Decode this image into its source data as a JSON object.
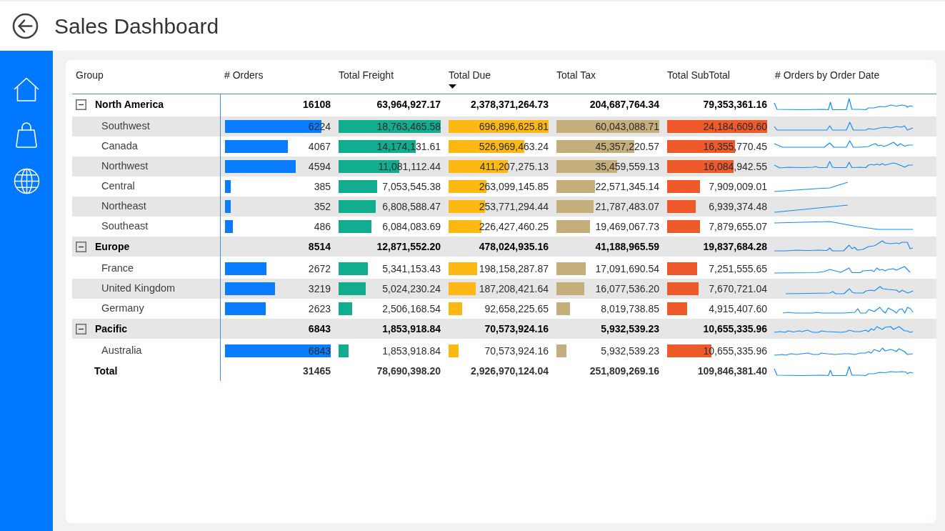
{
  "header": {
    "title": "Sales Dashboard"
  },
  "table": {
    "columns": [
      {
        "label": "Group",
        "kind": "label",
        "sorted": false
      },
      {
        "label": "# Orders",
        "kind": "measure",
        "sorted": false,
        "color": "#0a7cff"
      },
      {
        "label": "Total Freight",
        "kind": "measure",
        "sorted": false,
        "color": "#12ac8e"
      },
      {
        "label": "Total Due",
        "kind": "measure",
        "sorted": true,
        "color": "#fdb813"
      },
      {
        "label": "Total Tax",
        "kind": "measure",
        "sorted": false,
        "color": "#c4ae7b"
      },
      {
        "label": "Total SubTotal",
        "kind": "measure",
        "sorted": false,
        "color": "#ef5a2a"
      },
      {
        "label": "# Orders by Order Date",
        "kind": "sparkline",
        "sorted": false
      }
    ],
    "rows": [
      {
        "label": "North America",
        "expanded": true,
        "cells": [
          "16108",
          "63,964,927.17",
          "2,378,371,264.73",
          "204,687,764.34",
          "79,353,361.16"
        ],
        "children": [
          {
            "label": "Southwest",
            "cells": [
              {
                "value": "6224",
                "level": 0.91
              },
              {
                "value": "18,763,465.58",
                "level": 1
              },
              {
                "value": "696,896,625.81",
                "level": 1
              },
              {
                "value": "60,043,088.71",
                "level": 1
              },
              {
                "value": "24,184,609.60",
                "level": 1
              }
            ]
          },
          {
            "label": "Canada",
            "cells": [
              {
                "value": "4067",
                "level": 0.594
              },
              {
                "value": "14,174,131.61",
                "level": 0.755
              },
              {
                "value": "526,969,463.24",
                "level": 0.756
              },
              {
                "value": "45,357,220.57",
                "level": 0.755
              },
              {
                "value": "16,355,770.45",
                "level": 0.676
              }
            ]
          },
          {
            "label": "Northwest",
            "cells": [
              {
                "value": "4594",
                "level": 0.671
              },
              {
                "value": "11,081,112.44",
                "level": 0.591
              },
              {
                "value": "411,207,275.13",
                "level": 0.59
              },
              {
                "value": "35,459,559.13",
                "level": 0.591
              },
              {
                "value": "16,084,942.55",
                "level": 0.665
              }
            ]
          },
          {
            "label": "Central",
            "cells": [
              {
                "value": "385",
                "level": 0.056
              },
              {
                "value": "7,053,545.38",
                "level": 0.376
              },
              {
                "value": "263,099,145.85",
                "level": 0.378
              },
              {
                "value": "22,571,345.14",
                "level": 0.376
              },
              {
                "value": "7,909,009.01",
                "level": 0.327
              }
            ]
          },
          {
            "label": "Northeast",
            "cells": [
              {
                "value": "352",
                "level": 0.051
              },
              {
                "value": "6,808,588.47",
                "level": 0.363
              },
              {
                "value": "253,771,294.44",
                "level": 0.364
              },
              {
                "value": "21,787,483.07",
                "level": 0.363
              },
              {
                "value": "6,939,374.48",
                "level": 0.287
              }
            ]
          },
          {
            "label": "Southeast",
            "cells": [
              {
                "value": "486",
                "level": 0.071
              },
              {
                "value": "6,084,083.69",
                "level": 0.324
              },
              {
                "value": "226,427,460.25",
                "level": 0.325
              },
              {
                "value": "19,469,067.73",
                "level": 0.324
              },
              {
                "value": "7,879,655.07",
                "level": 0.326
              }
            ]
          }
        ]
      },
      {
        "label": "Europe",
        "expanded": true,
        "cells": [
          "8514",
          "12,871,552.20",
          "478,024,935.16",
          "41,188,965.59",
          "19,837,684.28"
        ],
        "children": [
          {
            "label": "France",
            "cells": [
              {
                "value": "2672",
                "level": 0.39
              },
              {
                "value": "5,341,153.43",
                "level": 0.285
              },
              {
                "value": "198,158,287.87",
                "level": 0.284
              },
              {
                "value": "17,091,690.54",
                "level": 0.285
              },
              {
                "value": "7,251,555.65",
                "level": 0.3
              }
            ]
          },
          {
            "label": "United Kingdom",
            "cells": [
              {
                "value": "3219",
                "level": 0.47
              },
              {
                "value": "5,024,230.24",
                "level": 0.268
              },
              {
                "value": "187,208,421.64",
                "level": 0.269
              },
              {
                "value": "16,077,536.20",
                "level": 0.268
              },
              {
                "value": "7,670,721.04",
                "level": 0.317
              }
            ]
          },
          {
            "label": "Germany",
            "cells": [
              {
                "value": "2623",
                "level": 0.383
              },
              {
                "value": "2,506,168.54",
                "level": 0.134
              },
              {
                "value": "92,658,225.65",
                "level": 0.133
              },
              {
                "value": "8,019,738.85",
                "level": 0.134
              },
              {
                "value": "4,915,407.60",
                "level": 0.203
              }
            ]
          }
        ]
      },
      {
        "label": "Pacific",
        "expanded": true,
        "cells": [
          "6843",
          "1,853,918.84",
          "70,573,924.16",
          "5,932,539.23",
          "10,655,335.96"
        ],
        "children": [
          {
            "label": "Australia",
            "cells": [
              {
                "value": "6843",
                "level": 1
              },
              {
                "value": "1,853,918.84",
                "level": 0.099
              },
              {
                "value": "70,573,924.16",
                "level": 0.101
              },
              {
                "value": "5,932,539.23",
                "level": 0.099
              },
              {
                "value": "10,655,335.96",
                "level": 0.441
              }
            ]
          }
        ]
      }
    ],
    "total": {
      "label": "Total",
      "cells": [
        "31465",
        "78,690,398.20",
        "2,926,970,124.04",
        "251,809,269.16",
        "109,846,381.40"
      ]
    }
  }
}
